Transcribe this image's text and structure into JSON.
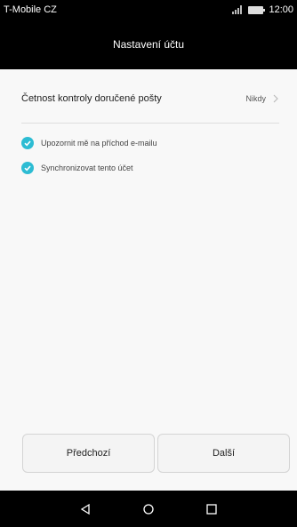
{
  "status_bar": {
    "carrier": "T-Mobile CZ",
    "time": "12:00"
  },
  "header": {
    "title": "Nastavení účtu"
  },
  "settings": {
    "frequency_label": "Četnost kontroly doručené pošty",
    "frequency_value": "Nikdy",
    "checkboxes": [
      {
        "label": "Upozornit mě na příchod e-mailu",
        "checked": true
      },
      {
        "label": "Synchronizovat tento účet",
        "checked": true
      }
    ]
  },
  "buttons": {
    "previous": "Předchozí",
    "next": "Další"
  },
  "colors": {
    "accent": "#2dbcd3"
  },
  "navigation": {
    "icons": [
      "back-icon",
      "home-icon",
      "recent-apps-icon"
    ]
  }
}
